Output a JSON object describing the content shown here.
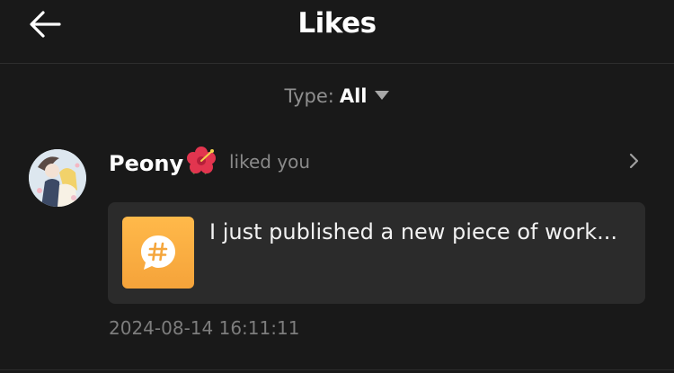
{
  "header": {
    "title": "Likes",
    "back_icon": "arrow-left-icon"
  },
  "filter": {
    "label": "Type:",
    "value": "All",
    "icon": "caret-down-icon"
  },
  "notifications": [
    {
      "user_name": "Peony",
      "name_emoji_icon": "hibiscus-flower-icon",
      "action": "liked you",
      "post_preview": "I just published a new piece of work...",
      "post_icon": "hashtag-chat-bubble-icon",
      "post_icon_color": "#F8AE3F",
      "timestamp": "2024-08-14 16:11:11"
    }
  ],
  "colors": {
    "background": "#191919",
    "card": "#2B2B2B",
    "muted_text": "#8A8A8A"
  }
}
